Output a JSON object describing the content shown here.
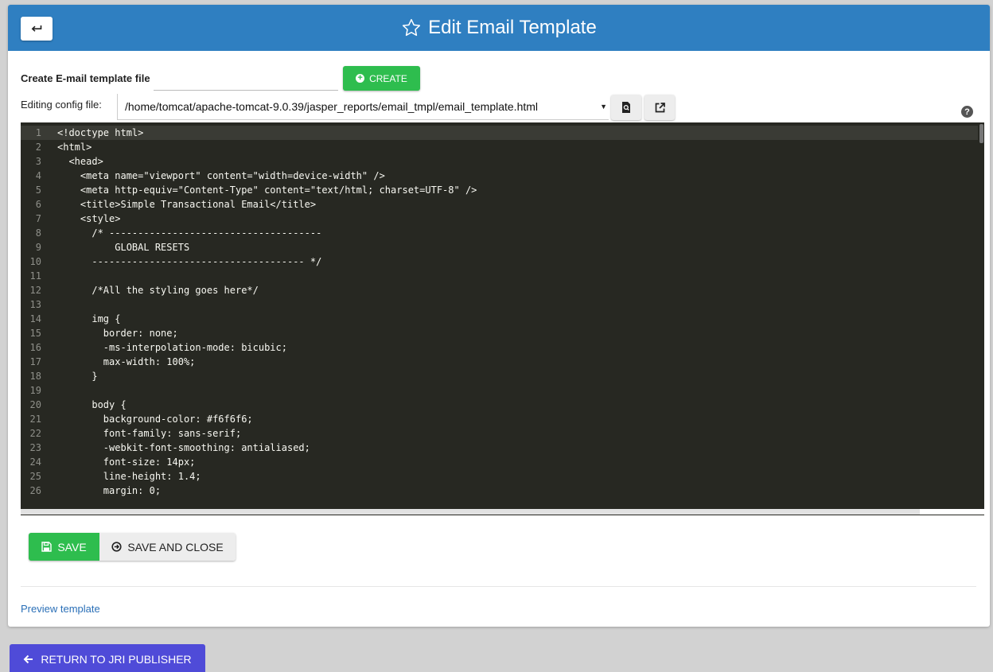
{
  "header": {
    "title": "Edit Email Template",
    "back_icon": "return-arrow-icon",
    "title_icon": "star-outline-icon"
  },
  "create": {
    "label": "Create E-mail template file",
    "input_value": "",
    "button_label": "CREATE",
    "button_icon": "plus-circle-icon"
  },
  "config": {
    "label": "Editing config file:",
    "selected_file": "/home/tomcat/apache-tomcat-9.0.39/jasper_reports/email_tmpl/email_template.html",
    "view_icon": "file-search-icon",
    "open_icon": "open-external-icon",
    "help_icon": "question-circle-icon"
  },
  "editor": {
    "line_numbers": [
      "1",
      "2",
      "3",
      "4",
      "5",
      "6",
      "7",
      "8",
      "9",
      "10",
      "11",
      "12",
      "13",
      "14",
      "15",
      "16",
      "17",
      "18",
      "19",
      "20",
      "21",
      "22",
      "23",
      "24",
      "25",
      "26"
    ],
    "lines": [
      "<!doctype html>",
      "<html>",
      "  <head>",
      "    <meta name=\"viewport\" content=\"width=device-width\" />",
      "    <meta http-equiv=\"Content-Type\" content=\"text/html; charset=UTF-8\" />",
      "    <title>Simple Transactional Email</title>",
      "    <style>",
      "      /* -------------------------------------",
      "          GLOBAL RESETS",
      "      ------------------------------------- */",
      "",
      "      /*All the styling goes here*/",
      "",
      "      img {",
      "        border: none;",
      "        -ms-interpolation-mode: bicubic;",
      "        max-width: 100%;",
      "      }",
      "",
      "      body {",
      "        background-color: #f6f6f6;",
      "        font-family: sans-serif;",
      "        -webkit-font-smoothing: antialiased;",
      "        font-size: 14px;",
      "        line-height: 1.4;",
      "        margin: 0;"
    ]
  },
  "actions": {
    "save_label": "SAVE",
    "save_close_label": "SAVE AND CLOSE",
    "save_icon": "floppy-disk-icon",
    "save_close_icon": "circle-arrow-icon"
  },
  "preview_link": "Preview template",
  "return_button": {
    "label": "RETURN TO JRI PUBLISHER",
    "icon": "arrow-left-icon"
  },
  "colors": {
    "header": "#2f7fc1",
    "success": "#2ebd4e",
    "editor_bg": "#272822",
    "return_button": "#4f4bd8",
    "link": "#2a6fb7"
  }
}
